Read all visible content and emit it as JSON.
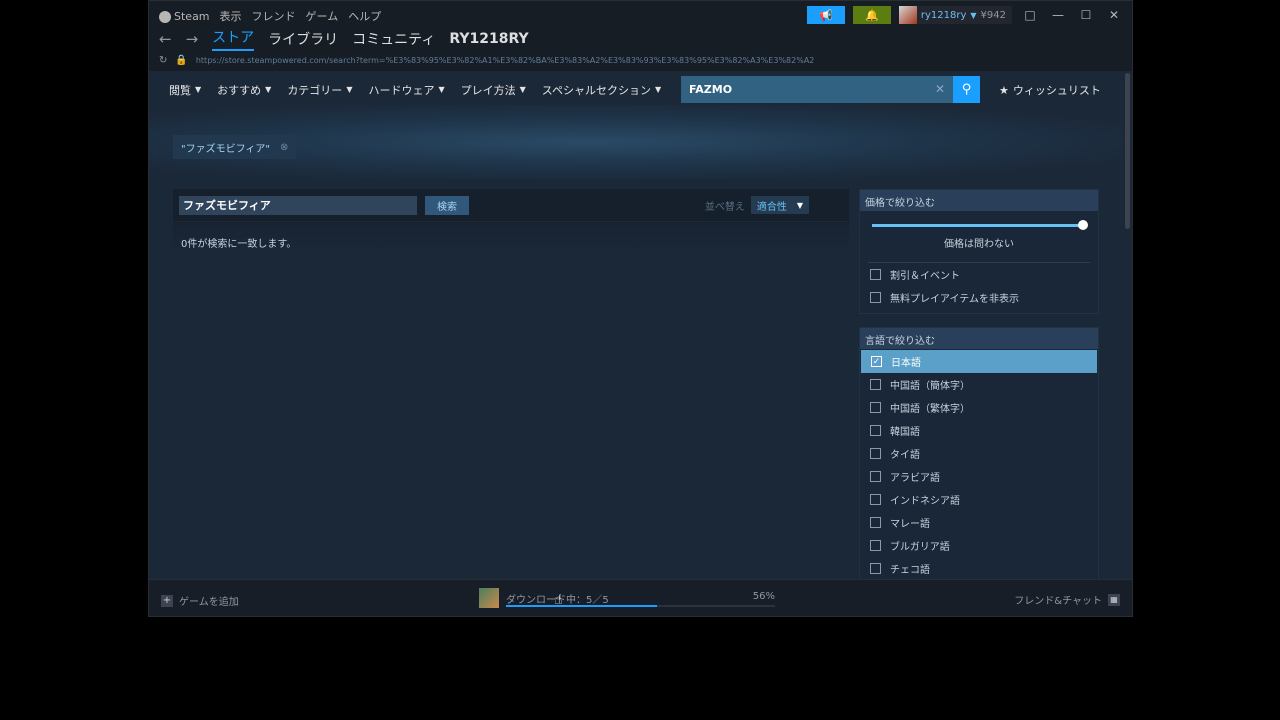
{
  "titlebar": {
    "menu": [
      "Steam",
      "表示",
      "フレンド",
      "ゲーム",
      "ヘルプ"
    ],
    "account_name": "ry1218ry",
    "wallet": "¥942"
  },
  "nav": {
    "tabs": [
      "ストア",
      "ライブラリ",
      "コミュニティ",
      "RY1218RY"
    ],
    "active_tab": "ストア"
  },
  "url": "https://store.steampowered.com/search?term=%E3%83%95%E3%82%A1%E3%82%BA%E3%83%A2%E3%83%93%E3%83%95%E3%82%A3%E3%82%A2",
  "store_nav": {
    "items": [
      "閲覧",
      "おすすめ",
      "カテゴリー",
      "ハードウェア",
      "プレイ方法",
      "スペシャルセクション"
    ],
    "search_value": "FAZMO",
    "wishlist": "ウィッシュリスト"
  },
  "tag": "\"ファズモビフィア\"",
  "results": {
    "term": "ファズモビフィア",
    "search_button": "検索",
    "sort_label": "並べ替え",
    "sort_value": "適合性",
    "no_results": "0件が検索に一致します。"
  },
  "price_filter": {
    "header": "価格で絞り込む",
    "price_value": 1.0,
    "price_label": "価格は問わない",
    "options": [
      "割引＆イベント",
      "無料プレイアイテムを非表示"
    ]
  },
  "language_filter": {
    "header": "言語で絞り込む",
    "options": [
      {
        "label": "日本語",
        "checked": true
      },
      {
        "label": "中国語（簡体字）",
        "checked": false
      },
      {
        "label": "中国語（繁体字）",
        "checked": false
      },
      {
        "label": "韓国語",
        "checked": false
      },
      {
        "label": "タイ語",
        "checked": false
      },
      {
        "label": "アラビア語",
        "checked": false
      },
      {
        "label": "インドネシア語",
        "checked": false
      },
      {
        "label": "マレー語",
        "checked": false
      },
      {
        "label": "ブルガリア語",
        "checked": false
      },
      {
        "label": "チェコ語",
        "checked": false
      }
    ]
  },
  "bottom": {
    "add_game": "ゲームを追加",
    "download_label": "ダウンロード中：5／5",
    "download_percent": "56%",
    "download_progress": 0.56,
    "friends": "フレンド&チャット"
  }
}
